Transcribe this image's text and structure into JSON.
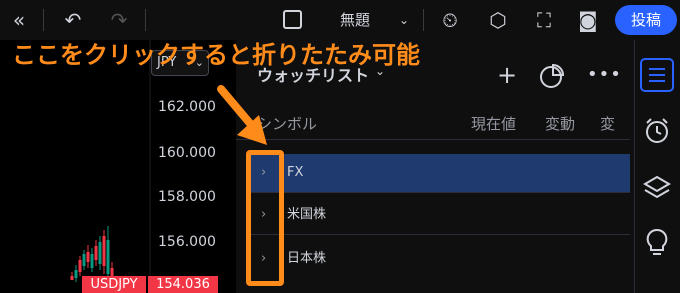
{
  "toolbar": {
    "back_icon": "double-chevron-left-icon",
    "undo_icon": "undo-icon",
    "redo_icon": "redo-icon",
    "layout_icon": "layout-square-icon",
    "title": "無題",
    "title_dropdown_icon": "chevron-down-icon",
    "alert_icon": "alert-clock-icon",
    "indicators_icon": "hexagon-icon",
    "fullscreen_icon": "fullscreen-icon",
    "snapshot_icon": "camera-icon",
    "publish_label": "投稿"
  },
  "chart": {
    "currency": "JPY",
    "price_labels": [
      "162.000",
      "160.000",
      "158.000",
      "156.000"
    ],
    "symbol": "USDJPY",
    "last_price": "154.036",
    "colors": {
      "down": "#f23645",
      "up": "#089981"
    }
  },
  "watchlist": {
    "title": "ウォッチリスト",
    "add_icon": "plus-icon",
    "stats_icon": "pie-chart-icon",
    "more_icon": "more-horizontal-icon",
    "columns": [
      "シンボル",
      "現在値",
      "変動",
      "変"
    ],
    "groups": [
      {
        "label": "FX",
        "selected": true
      },
      {
        "label": "米国株",
        "selected": false
      },
      {
        "label": "日本株",
        "selected": false
      }
    ],
    "selected_color": "#1e3a6e"
  },
  "right_sidebar": {
    "items": [
      "watchlist-icon",
      "alarm-clock-icon",
      "layers-icon",
      "lightbulb-icon"
    ],
    "active_color": "#2962ff"
  },
  "annotation": {
    "text": "ここをクリックすると折りたたみ可能",
    "color": "#ff8c1a"
  }
}
